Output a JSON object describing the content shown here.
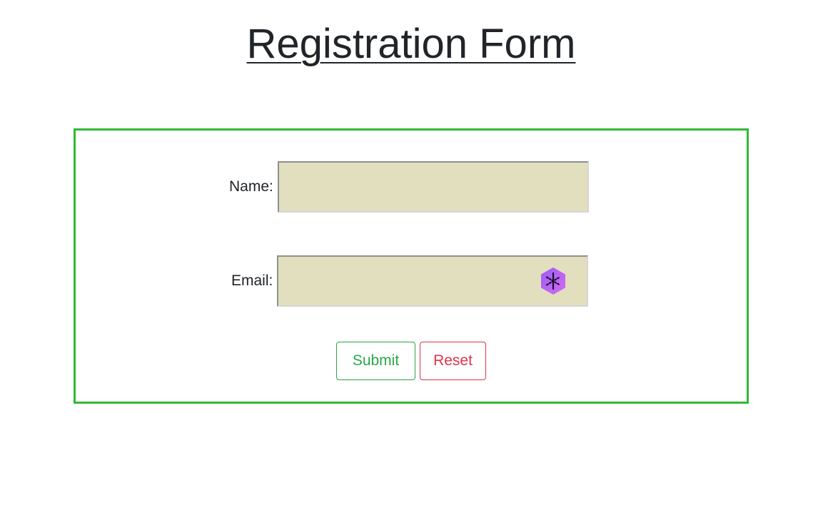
{
  "page": {
    "title": "Registration Form"
  },
  "form": {
    "name_label": "Name:",
    "name_value": "",
    "email_label": "Email:",
    "email_value": "",
    "submit_label": "Submit",
    "reset_label": "Reset",
    "extension_icon": "hexagon-asterisk-icon"
  },
  "colors": {
    "form_border": "#32b832",
    "input_background": "#e2dfbe",
    "submit": "#28a745",
    "reset": "#dc3545",
    "extension_icon": "#b45cf0"
  }
}
